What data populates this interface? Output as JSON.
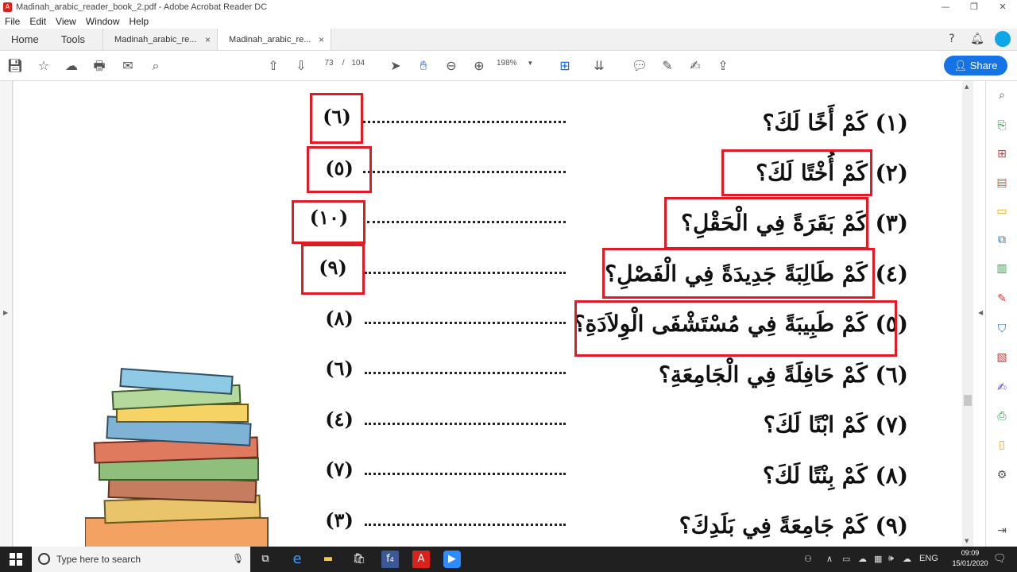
{
  "window": {
    "title": "Madinah_arabic_reader_book_2.pdf - Adobe Acrobat Reader DC",
    "minimize": "—",
    "restore": "❐",
    "close": "✕"
  },
  "menu": {
    "items": [
      "File",
      "Edit",
      "View",
      "Window",
      "Help"
    ]
  },
  "tabs": {
    "home": "Home",
    "tools": "Tools",
    "documents": [
      {
        "label": "Madinah_arabic_re...",
        "close": "×"
      },
      {
        "label": "Madinah_arabic_re...",
        "close": "×"
      }
    ]
  },
  "toolbar": {
    "current_page": "73",
    "separator": "/",
    "total_pages": "104",
    "zoom": "198%",
    "share_label": "Share"
  },
  "exercise": {
    "rows": [
      {
        "question": "(١) كَمْ أَخًا لَكَ؟",
        "answer": "(٦)"
      },
      {
        "question": "(٢) كَمْ أُخْتًا لَكَ؟",
        "answer": "(٥)"
      },
      {
        "question": "(٣) كَمْ بَقَرَةً فِي الْحَقْلِ؟",
        "answer": "(١٠)"
      },
      {
        "question": "(٤) كَمْ طَالِبَةً جَدِيدَةً فِي الْفَصْلِ؟",
        "answer": "(٩)"
      },
      {
        "question": "(٥) كَمْ طَبِيبَةً فِي مُسْتَشْفَى الْوِلاَدَةِ؟",
        "answer": "(٨)"
      },
      {
        "question": "(٦) كَمْ حَافِلَةً فِي الْجَامِعَةِ؟",
        "answer": "(٦)"
      },
      {
        "question": "(٧) كَمْ ابْنًا لَكَ؟",
        "answer": "(٤)"
      },
      {
        "question": "(٨) كَمْ بِنْتًا لَكَ؟",
        "answer": "(٧)"
      },
      {
        "question": "(٩) كَمْ جَامِعَةً فِي بَلَدِكَ؟",
        "answer": "(٣)"
      }
    ]
  },
  "taskbar": {
    "search_placeholder": "Type here to search",
    "language": "ENG",
    "time": "09:09",
    "date": "15/01/2020",
    "facebook_badge": "4"
  },
  "colors": {
    "annotation_red": "#e01b24",
    "share_blue": "#1473e6"
  }
}
